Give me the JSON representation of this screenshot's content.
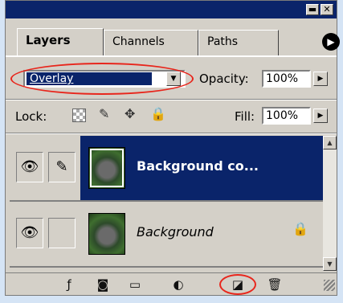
{
  "tabs": [
    {
      "label": "Layers",
      "active": true
    },
    {
      "label": "Channels",
      "active": false
    },
    {
      "label": "Paths",
      "active": false
    }
  ],
  "window_buttons": {
    "minimize": "▬",
    "close": "✕"
  },
  "blend": {
    "mode": "Overlay",
    "opacity_label": "Opacity:",
    "opacity_value": "100%"
  },
  "lock": {
    "label": "Lock:"
  },
  "fill": {
    "label": "Fill:",
    "value": "100%"
  },
  "layers": [
    {
      "name": "Background co...",
      "selected": true,
      "locked": false
    },
    {
      "name": "Background",
      "selected": false,
      "locked": true,
      "italic": true
    }
  ],
  "colors": {
    "panel_bg": "#d4d0c8",
    "title_bar": "#0a246a",
    "selection": "#0a246a",
    "highlight_ring": "#e8261c",
    "frame_blue": "#d5e4f5"
  },
  "icons": [
    "panel-menu-arrow-icon",
    "eye-icon",
    "brush-link-icon",
    "lock-transparency-icon",
    "lock-paint-icon",
    "lock-move-icon",
    "lock-all-icon",
    "layer-lock-icon",
    "layer-style-icon",
    "layer-mask-icon",
    "new-set-icon",
    "adjustment-layer-icon",
    "new-layer-icon",
    "trash-icon"
  ]
}
